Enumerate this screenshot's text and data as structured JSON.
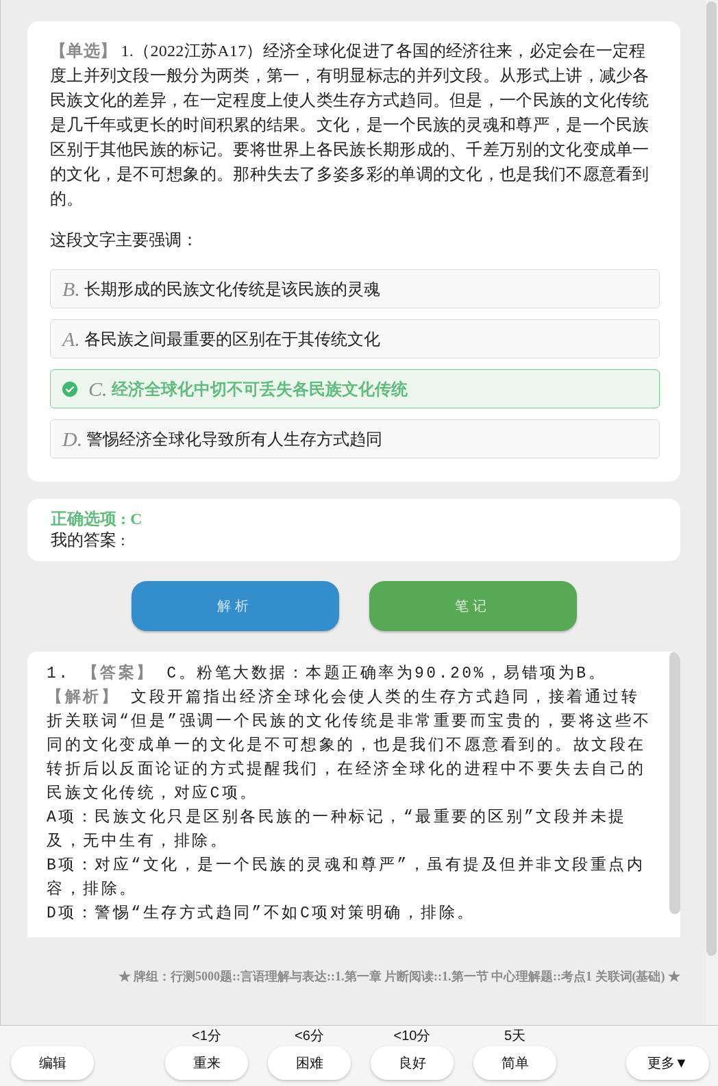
{
  "question": {
    "text": "**【单选】** 1.（2022江苏A17）经济全球化促进了各国的经济往来，必定会在一定程度上并列文段一般分为两类，第一，有明显标志的并列文段。从形式上讲，减少各民族文化的差异，在一定程度上使人类生存方式趋同。但是，一个民族的文化传统是几千年或更长的时间积累的结果。文化，是一个民族的灵魂和尊严，是一个民族区别于其他民族的标记。要将世界上各民族长期形成的、千差万别的文化变成单一的文化，是不可想象的。那种失去了多姿多彩的单调的文化，也是我们不愿意看到的。",
    "prompt": "这段文字主要强调："
  },
  "options": [
    {
      "letter": "B.",
      "text": "长期形成的民族文化传统是该民族的灵魂",
      "correct": false
    },
    {
      "letter": "A.",
      "text": "各民族之间最重要的区别在于其传统文化",
      "correct": false
    },
    {
      "letter": "C.",
      "text": "经济全球化中切不可丢失各民族文化传统",
      "correct": true
    },
    {
      "letter": "D.",
      "text": "警惕经济全球化导致所有人生存方式趋同",
      "correct": false
    }
  ],
  "result": {
    "correct_answer": "正确选项 : C",
    "my_answer": "我的答案 :"
  },
  "actions": [
    {
      "label": "解析",
      "kind": "analysis"
    },
    {
      "label": "笔记",
      "kind": "notes"
    }
  ],
  "explanation": {
    "paragraphs": [
      "1. **【答案】** C。粉笔大数据：本题正确率为90.20%，易错项为B。",
      "**【解析】** 文段开篇指出经济全球化会使人类的生存方式趋同，接着通过转折关联词“但是”强调一个民族的文化传统是非常重要而宝贵的，要将这些不同的文化变成单一的文化是不可想象的，也是我们不愿意看到的。故文段在转折后以反面论证的方式提醒我们，在经济全球化的进程中不要失去自己的民族文化传统，对应C项。",
      "A项：民族文化只是区别各民族的一种标记，“最重要的区别”文段并未提及，无中生有，排除。",
      "B项：对应“文化，是一个民族的灵魂和尊严”，虽有提及但并非文段重点内容，排除。",
      "D项：警惕“生存方式趋同”不如C项对策明确，排除。"
    ]
  },
  "deck_path": "★ 牌组：行测5000题::言语理解与表达::1.第一章 片断阅读::1.第一节 中心理解题::考点1 关联词(基础) ★",
  "bottom_bar": {
    "edit": "编辑",
    "ratings": [
      {
        "interval": "<1分",
        "label": "重来"
      },
      {
        "interval": "<6分",
        "label": "困难"
      },
      {
        "interval": "<10分",
        "label": "良好"
      },
      {
        "interval": "5天",
        "label": "简单"
      }
    ],
    "more": "更多▼"
  }
}
